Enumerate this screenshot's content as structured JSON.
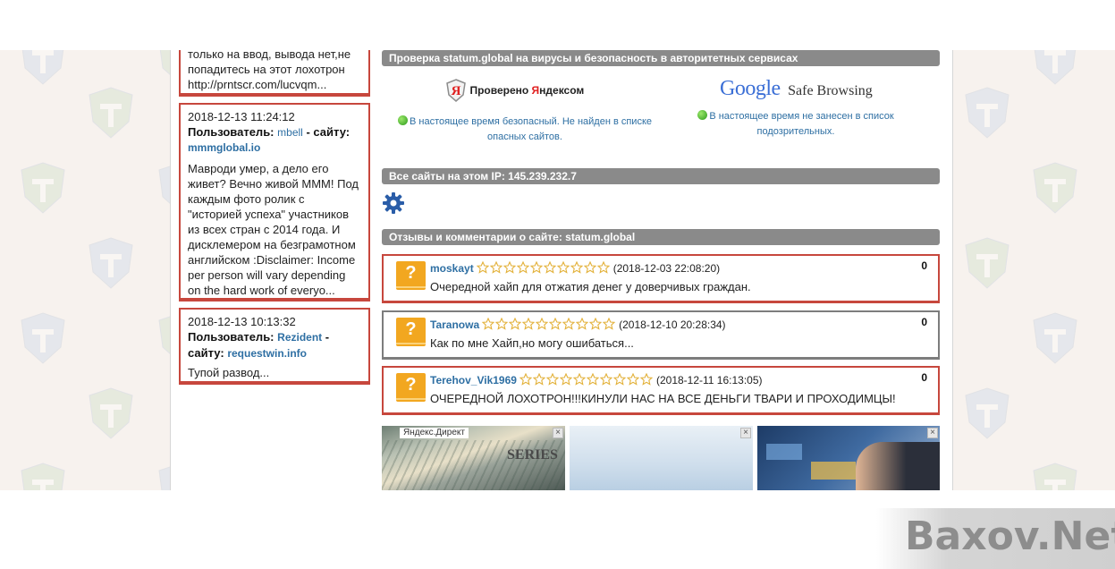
{
  "left_comments": [
    {
      "partial_text_lines": [
        "только на ввод, вывода нет,не",
        "попадитесь на этот лохотрон",
        "http://prntscr.com/lucvqm..."
      ]
    },
    {
      "date": "2018-12-13 11:24:12",
      "user_label": "Пользователь:",
      "user": "mbell",
      "site_label": "- сайту:",
      "site": "mmmglobal.io",
      "text": "Мавроди умер, а дело его живет? Вечно живой МММ! Под каждым фото ролик с \"историей успеха\" участников из всех стран с 2014 года. И дисклемером на безграмотном английском :Disclaimer: Income per person will vary depending on the hard work of everyo..."
    },
    {
      "date": "2018-12-13 10:13:32",
      "user_label": "Пользователь:",
      "user": "Rezident",
      "site_label": "- сайту:",
      "site": "requestwin.info",
      "text": "Тупой развод..."
    }
  ],
  "security": {
    "bar_title": "Проверка statum.global на вирусы и безопасность в авторитетных сервисах",
    "yandex": {
      "label_prefix": "Проверено ",
      "label_brand_first": "Я",
      "label_brand_rest": "ндексом",
      "status": "В настоящее время безопасный. Не найден в списке опасных сайтов."
    },
    "google": {
      "logo": "Google",
      "product": "Safe Browsing",
      "status": "В настоящее время не занесен в список подозрительных."
    }
  },
  "ip_bar": "Все сайты на этом IP: 145.239.232.7",
  "reviews_bar": "Отзывы и комментарии о сайте: statum.global",
  "reviews": [
    {
      "user": "moskayt",
      "date": "(2018-12-03 22:08:20)",
      "score": "0",
      "text": "Очередной хайп для отжатия денег у доверчивых граждан.",
      "border": "red",
      "stars": 10
    },
    {
      "user": "Taranowa",
      "date": "(2018-12-10 20:28:34)",
      "score": "0",
      "text": "Как по мне Хайп,но могу ошибаться...",
      "border": "grey",
      "stars": 10
    },
    {
      "user": "Terehov_Vik1969",
      "date": "(2018-12-11 16:13:05)",
      "score": "0",
      "text": "ОЧЕРЕДНОЙ ЛОХОТРОН!!!КИНУЛИ НАС НА ВСЕ ДЕНЬГИ ТВАРИ И ПРОХОДИМЦЫ!",
      "border": "red",
      "stars": 10
    }
  ],
  "ads": {
    "label": "Яндекс.Директ",
    "close": "×",
    "banner_text": "SERIES"
  },
  "watermark": "Baxov.Net",
  "colors": {
    "accent_red": "#c7473d",
    "link_blue": "#2e6fa3",
    "bar_grey": "#8a8a8a",
    "avatar_orange": "#f2a720",
    "gear_blue": "#2a5da8"
  },
  "icons": {
    "gear": "settings-gear-icon",
    "check": "green-check-icon",
    "star": "empty-star-icon",
    "avatar": "question-avatar-icon"
  }
}
